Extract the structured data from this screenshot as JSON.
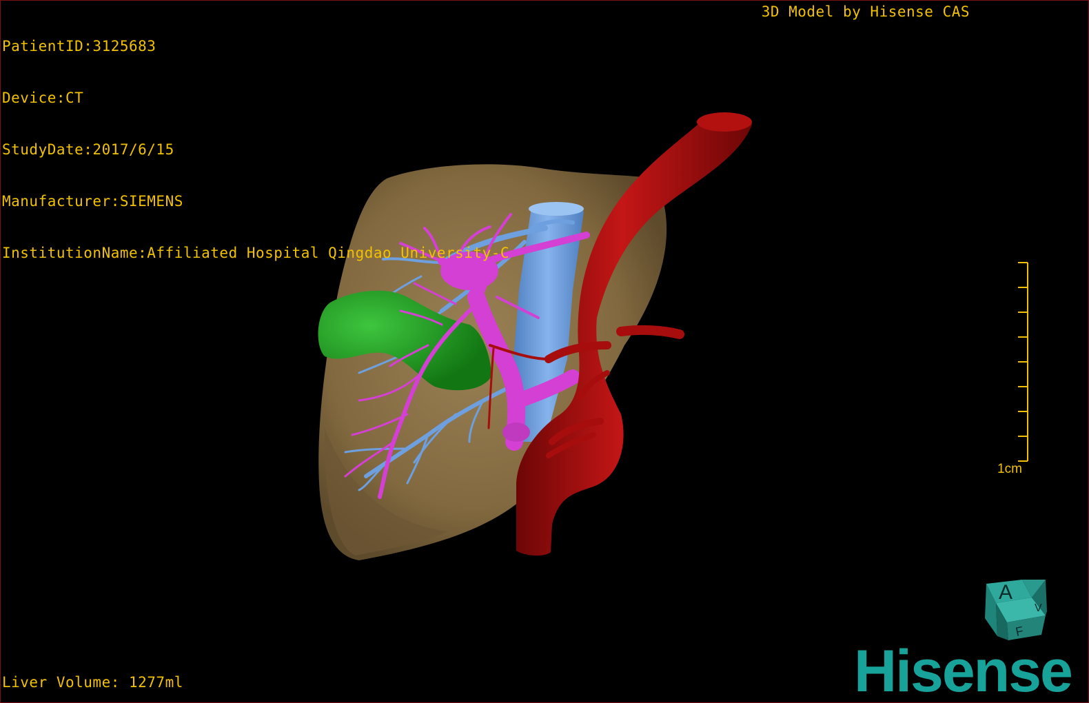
{
  "overlay": {
    "info_lines": [
      "PatientID:3125683",
      "Device:CT",
      "StudyDate:2017/6/15",
      "Manufacturer:SIEMENS",
      "InstitutionName:Affiliated Hospital Qingdao University-C"
    ],
    "brand_title": "3D Model by Hisense CAS",
    "liver_volume": "Liver Volume: 1277ml"
  },
  "scale": {
    "label": "1cm",
    "ticks": 9
  },
  "orientation_cube": {
    "face_front": "A",
    "face_bottom": "F",
    "face_right": "V"
  },
  "logo": {
    "text": "Hisense"
  },
  "model": {
    "structures": [
      {
        "name": "liver",
        "color": "#8a7148"
      },
      {
        "name": "aorta",
        "color": "#a70d0d"
      },
      {
        "name": "inferior-vena-cava",
        "color": "#6e9fde"
      },
      {
        "name": "hepatic-veins",
        "color": "#6e9fde"
      },
      {
        "name": "portal-vein",
        "color": "#d43fd4"
      },
      {
        "name": "gallbladder-tumor",
        "color": "#1e9a1e"
      }
    ]
  },
  "colors": {
    "overlay_text": "#f2c200",
    "logo": "#17a39a",
    "border": "#7a1010"
  }
}
